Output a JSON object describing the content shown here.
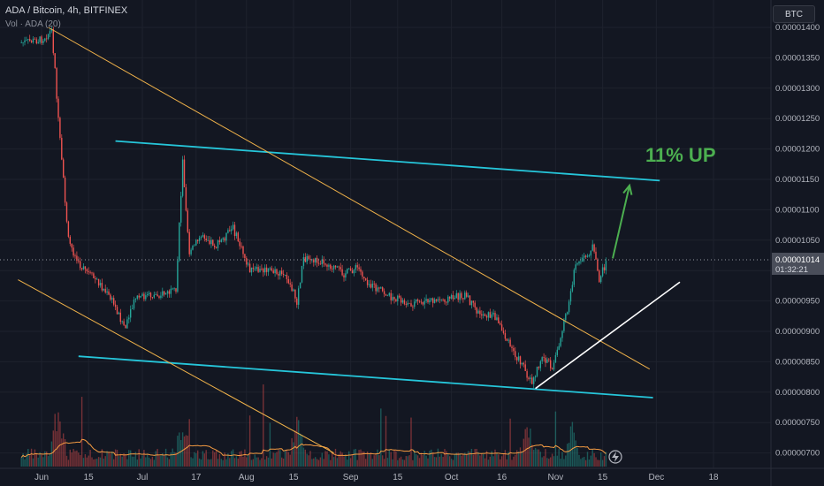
{
  "header": {
    "symbol_line": "ADA / Bitcoin, 4h, BITFINEX",
    "volume_line": "Vol · ADA (20)"
  },
  "currency_button": "BTC",
  "annotation": {
    "text": "11% UP",
    "color": "#4caf50"
  },
  "last_price": {
    "value": "0.00001014",
    "countdown": "01:32:21",
    "color": "#4a4e5a"
  },
  "colors": {
    "background": "#131722",
    "up": "#26a69a",
    "down": "#ef5350",
    "channel": "#26c6da",
    "wedge": "#f0b24a",
    "support": "#ffffff",
    "volume_ma": "#f59b42"
  },
  "chart_data": {
    "type": "candlestick",
    "yaxis_ticks": [
      "0.00001400",
      "0.00001350",
      "0.00001300",
      "0.00001250",
      "0.00001200",
      "0.00001150",
      "0.00001100",
      "0.00001050",
      "0.00001000",
      "0.00000950",
      "0.00000900",
      "0.00000850",
      "0.00000800",
      "0.00000750",
      "0.00000700"
    ],
    "xaxis_ticks": [
      "Jun",
      "15",
      "Jul",
      "17",
      "Aug",
      "15",
      "Sep",
      "15",
      "Oct",
      "16",
      "Nov",
      "15",
      "Dec",
      "18"
    ],
    "price_path": [
      [
        "2021-05-26",
        1.375e-05
      ],
      [
        "2021-06-01",
        1.38e-05
      ],
      [
        "2021-06-04",
        1.395e-05
      ],
      [
        "2021-06-05",
        1.33e-05
      ],
      [
        "2021-06-06",
        1.245e-05
      ],
      [
        "2021-06-07",
        1.18e-05
      ],
      [
        "2021-06-09",
        1.05e-05
      ],
      [
        "2021-06-12",
        1.01e-05
      ],
      [
        "2021-06-18",
        9.8e-06
      ],
      [
        "2021-06-22",
        9.5e-06
      ],
      [
        "2021-06-26",
        9.05e-06
      ],
      [
        "2021-06-29",
        9.55e-06
      ],
      [
        "2021-07-05",
        9.6e-06
      ],
      [
        "2021-07-11",
        9.65e-06
      ],
      [
        "2021-07-13",
        1.18e-05
      ],
      [
        "2021-07-15",
        1.03e-05
      ],
      [
        "2021-07-19",
        1.06e-05
      ],
      [
        "2021-07-23",
        1.04e-05
      ],
      [
        "2021-07-28",
        1.07e-05
      ],
      [
        "2021-08-02",
        1e-05
      ],
      [
        "2021-08-08",
        1e-05
      ],
      [
        "2021-08-13",
        9.9e-06
      ],
      [
        "2021-08-16",
        9.5e-06
      ],
      [
        "2021-08-18",
        1.02e-05
      ],
      [
        "2021-08-24",
        1.015e-05
      ],
      [
        "2021-08-30",
        9.95e-06
      ],
      [
        "2021-09-03",
        1.005e-05
      ],
      [
        "2021-09-07",
        9.75e-06
      ],
      [
        "2021-09-12",
        9.6e-06
      ],
      [
        "2021-09-18",
        9.45e-06
      ],
      [
        "2021-09-25",
        9.5e-06
      ],
      [
        "2021-10-01",
        9.55e-06
      ],
      [
        "2021-10-05",
        9.6e-06
      ],
      [
        "2021-10-09",
        9.3e-06
      ],
      [
        "2021-10-14",
        9.25e-06
      ],
      [
        "2021-10-18",
        8.8e-06
      ],
      [
        "2021-10-22",
        8.45e-06
      ],
      [
        "2021-10-25",
        8.15e-06
      ],
      [
        "2021-10-28",
        8.6e-06
      ],
      [
        "2021-10-31",
        8.4e-06
      ],
      [
        "2021-11-03",
        9e-06
      ],
      [
        "2021-11-05",
        9.5e-06
      ],
      [
        "2021-11-07",
        1.01e-05
      ],
      [
        "2021-11-10",
        1.02e-05
      ],
      [
        "2021-11-12",
        1.04e-05
      ],
      [
        "2021-11-14",
        9.85e-06
      ],
      [
        "2021-11-16",
        1.014e-05
      ]
    ],
    "volume_spikes": [
      [
        "2021-06-06",
        1.0
      ],
      [
        "2021-07-13",
        0.55
      ],
      [
        "2021-08-16",
        0.6
      ],
      [
        "2021-10-24",
        0.55
      ],
      [
        "2021-11-06",
        0.45
      ]
    ],
    "drawings": [
      {
        "kind": "channel-top",
        "p1": [
          "2021-06-23",
          1.213e-05
        ],
        "p2": [
          "2021-12-02",
          1.148e-05
        ]
      },
      {
        "kind": "channel-bottom",
        "p1": [
          "2021-06-12",
          8.59e-06
        ],
        "p2": [
          "2021-11-30",
          7.91e-06
        ]
      },
      {
        "kind": "wedge-upper",
        "p1": [
          "2021-06-03",
          1.4e-05
        ],
        "p2": [
          "2021-11-29",
          8.38e-06
        ]
      },
      {
        "kind": "wedge-lower",
        "p1": [
          "2021-05-25",
          9.85e-06
        ],
        "p2": [
          "2021-08-27",
          7e-06
        ]
      },
      {
        "kind": "support",
        "p1": [
          "2021-10-26",
          8.06e-06
        ],
        "p2": [
          "2021-12-08",
          9.81e-06
        ]
      },
      {
        "kind": "arrow",
        "p1": [
          "2021-11-18",
          1.02e-05
        ],
        "p2": [
          "2021-11-23",
          1.14e-05
        ]
      }
    ]
  }
}
